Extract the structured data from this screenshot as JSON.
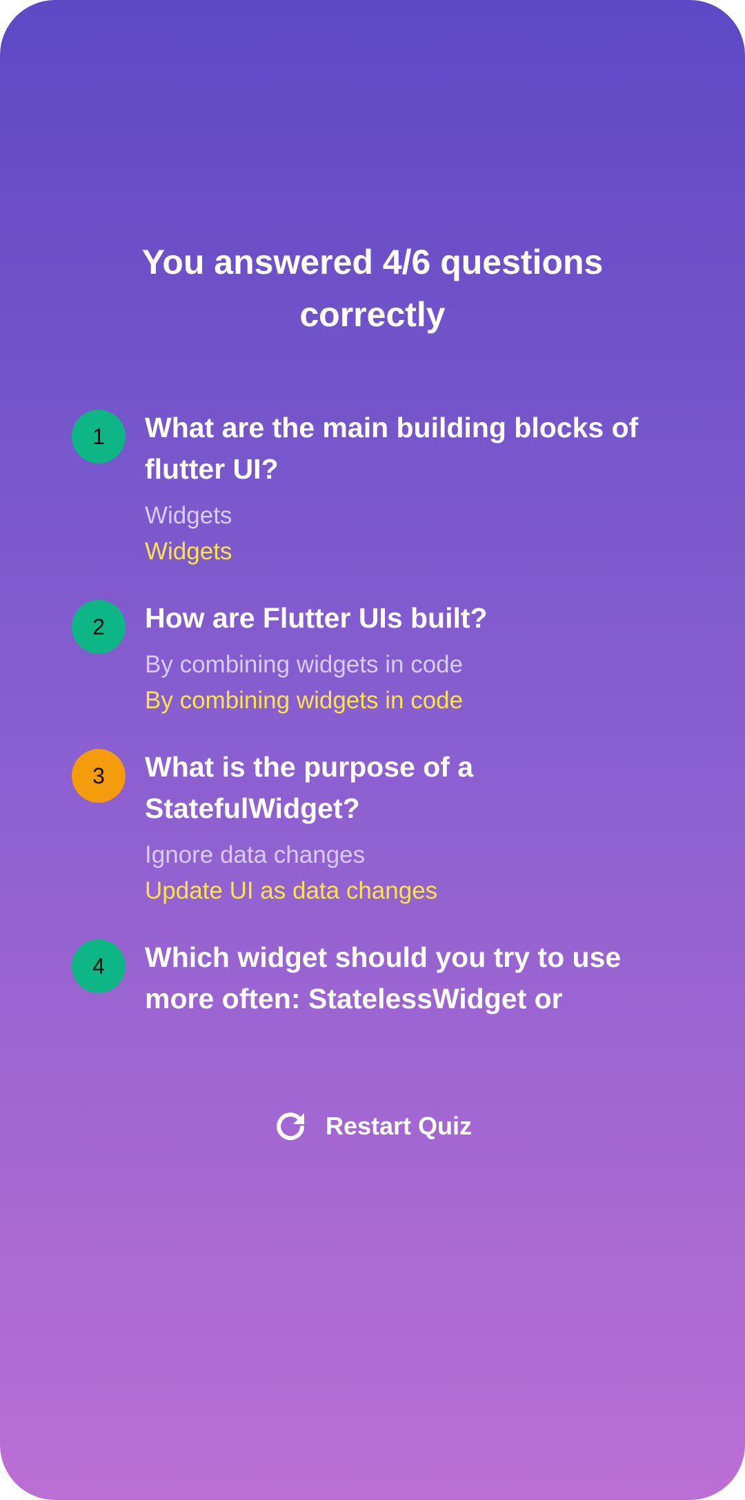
{
  "results": {
    "title": "You answered 4/6 questions correctly"
  },
  "summary": [
    {
      "number": "1",
      "question": "What are the main building blocks of flutter UI?",
      "user_answer": "Widgets",
      "correct_answer": "Widgets",
      "is_correct": true
    },
    {
      "number": "2",
      "question": "How are Flutter UIs built?",
      "user_answer": "By combining widgets in code",
      "correct_answer": "By combining widgets in code",
      "is_correct": true
    },
    {
      "number": "3",
      "question": "What is the purpose of a StatefulWidget?",
      "user_answer": "Ignore data changes",
      "correct_answer": "Update UI as data changes",
      "is_correct": false
    },
    {
      "number": "4",
      "question": "Which widget should you try to use more often: StatelessWidget or",
      "user_answer": "",
      "correct_answer": "",
      "is_correct": true
    }
  ],
  "restart": {
    "icon": "refresh-icon",
    "label": "Restart Quiz"
  },
  "colors": {
    "background_top": "#5d49c5",
    "background_bottom": "#bb6fd4",
    "correct_badge": "#0eb686",
    "wrong_badge": "#f59c0c",
    "correct_answer_text": "#fbe34c",
    "user_answer_text": "#d8ccf4"
  }
}
